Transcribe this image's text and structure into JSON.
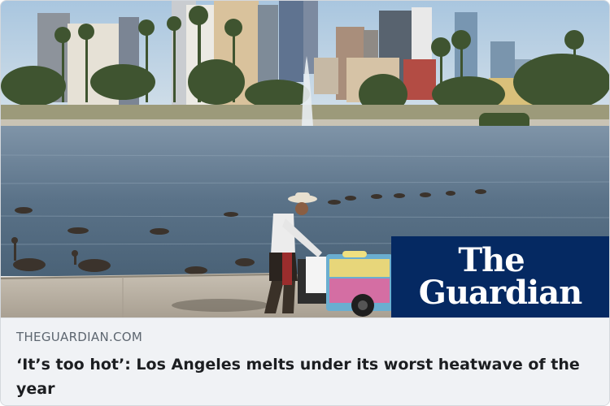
{
  "link_preview": {
    "image": {
      "alt_subject": "Man pushing a cart beside a lake with geese and a city skyline",
      "colors": {
        "sky": "#bcd3e6",
        "water": "#58728a",
        "walkway": "#b9b0a2"
      }
    },
    "brand": {
      "line1": "The",
      "line2": "Guardian",
      "background": "#052962"
    },
    "domain": "THEGUARDIAN.COM",
    "headline": "‘It’s too hot’: Los Angeles melts under its worst heatwave of the year"
  }
}
